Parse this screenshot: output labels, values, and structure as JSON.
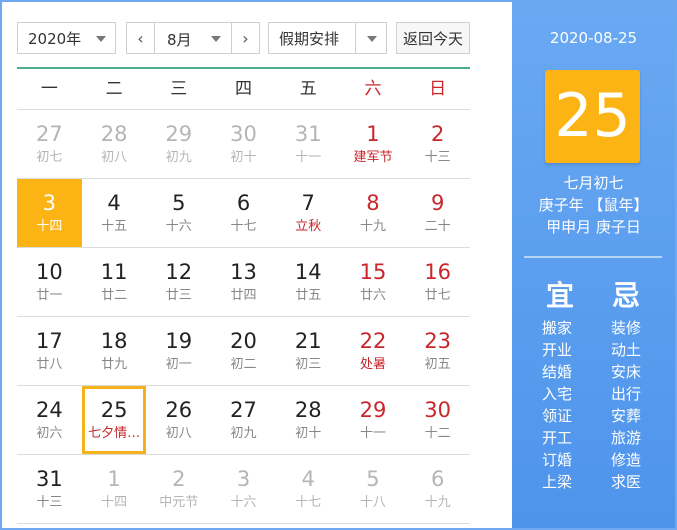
{
  "toolbar": {
    "year": "2020年",
    "month": "8月",
    "prev_icon": "‹",
    "next_icon": "›",
    "holiday": "假期安排",
    "today_button": "返回今天"
  },
  "weekdays": [
    "一",
    "二",
    "三",
    "四",
    "五",
    "六",
    "日"
  ],
  "weeks": [
    [
      {
        "d": "27",
        "l": "初七",
        "other": true
      },
      {
        "d": "28",
        "l": "初八",
        "other": true
      },
      {
        "d": "29",
        "l": "初九",
        "other": true
      },
      {
        "d": "30",
        "l": "初十",
        "other": true
      },
      {
        "d": "31",
        "l": "十一",
        "other": true
      },
      {
        "d": "1",
        "l": "建军节",
        "we": true,
        "hol": true
      },
      {
        "d": "2",
        "l": "十三",
        "we": true
      }
    ],
    [
      {
        "d": "3",
        "l": "十四",
        "selected": true
      },
      {
        "d": "4",
        "l": "十五"
      },
      {
        "d": "5",
        "l": "十六"
      },
      {
        "d": "6",
        "l": "十七"
      },
      {
        "d": "7",
        "l": "立秋",
        "hol": true
      },
      {
        "d": "8",
        "l": "十九",
        "we": true
      },
      {
        "d": "9",
        "l": "二十",
        "we": true
      }
    ],
    [
      {
        "d": "10",
        "l": "廿一"
      },
      {
        "d": "11",
        "l": "廿二"
      },
      {
        "d": "12",
        "l": "廿三"
      },
      {
        "d": "13",
        "l": "廿四"
      },
      {
        "d": "14",
        "l": "廿五"
      },
      {
        "d": "15",
        "l": "廿六",
        "we": true
      },
      {
        "d": "16",
        "l": "廿七",
        "we": true
      }
    ],
    [
      {
        "d": "17",
        "l": "廿八"
      },
      {
        "d": "18",
        "l": "廿九"
      },
      {
        "d": "19",
        "l": "初一"
      },
      {
        "d": "20",
        "l": "初二"
      },
      {
        "d": "21",
        "l": "初三"
      },
      {
        "d": "22",
        "l": "处暑",
        "we": true,
        "hol": true
      },
      {
        "d": "23",
        "l": "初五",
        "we": true
      }
    ],
    [
      {
        "d": "24",
        "l": "初六"
      },
      {
        "d": "25",
        "l": "七夕情…",
        "today": true,
        "hol": true
      },
      {
        "d": "26",
        "l": "初八"
      },
      {
        "d": "27",
        "l": "初九"
      },
      {
        "d": "28",
        "l": "初十"
      },
      {
        "d": "29",
        "l": "十一",
        "we": true
      },
      {
        "d": "30",
        "l": "十二",
        "we": true
      }
    ],
    [
      {
        "d": "31",
        "l": "十三"
      },
      {
        "d": "1",
        "l": "十四",
        "other": true
      },
      {
        "d": "2",
        "l": "中元节",
        "other": true
      },
      {
        "d": "3",
        "l": "十六",
        "other": true
      },
      {
        "d": "4",
        "l": "十七",
        "other": true
      },
      {
        "d": "5",
        "l": "十八",
        "other": true,
        "we": true
      },
      {
        "d": "6",
        "l": "十九",
        "other": true,
        "we": true
      }
    ]
  ],
  "panel": {
    "date": "2020-08-25",
    "big_day": "25",
    "lunar": "七月初七",
    "year_gz": "庚子年 【鼠年】",
    "month_day_gz": "甲申月 庚子日",
    "yi_title": "宜",
    "ji_title": "忌",
    "yi": [
      "搬家",
      "开业",
      "结婚",
      "入宅",
      "领证",
      "开工",
      "订婚",
      "上梁"
    ],
    "ji": [
      "装修",
      "动土",
      "安床",
      "出行",
      "安葬",
      "旅游",
      "修造",
      "求医"
    ]
  },
  "colors": {
    "accent": "#fbb414",
    "panel": "#5a9eef",
    "weekend": "#c8262b"
  }
}
